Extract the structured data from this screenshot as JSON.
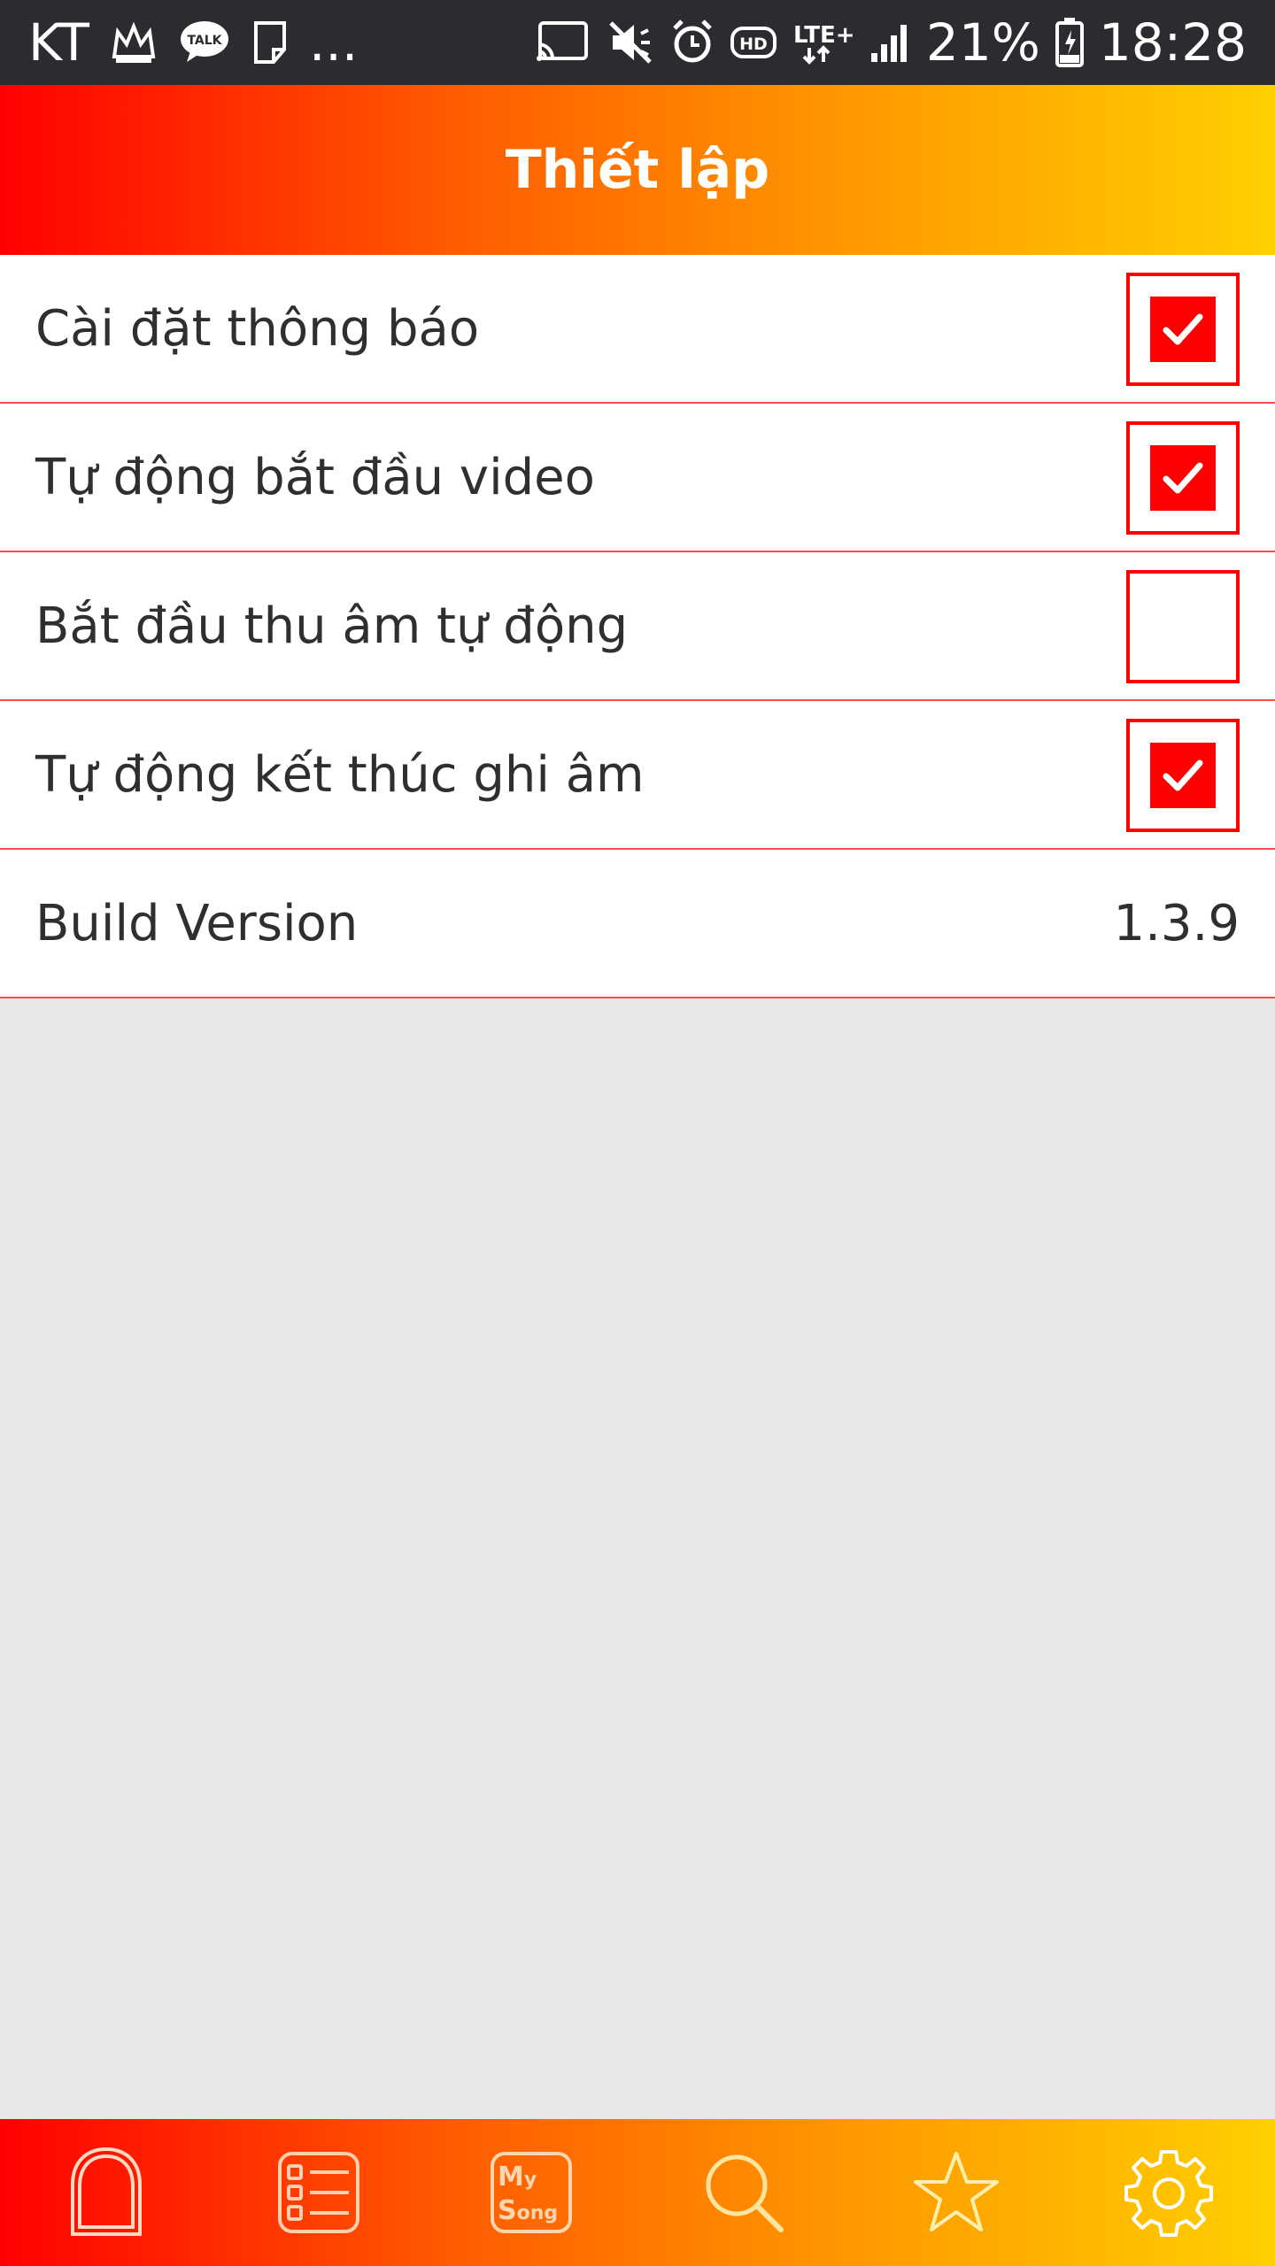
{
  "status_bar": {
    "carrier": "KT",
    "more": "...",
    "network": "LTE+",
    "battery": "21%",
    "time": "18:28",
    "left_icons": [
      "crown-icon",
      "kakaotalk-icon",
      "note-icon"
    ],
    "right_icons": [
      "cast-icon",
      "mute-icon",
      "alarm-icon",
      "hd-icon",
      "lte-icon",
      "signal-icon",
      "battery-icon"
    ]
  },
  "header": {
    "title": "Thiết lập"
  },
  "settings": [
    {
      "label": "Cài đặt thông báo",
      "checked": true
    },
    {
      "label": "Tự động bắt đầu video",
      "checked": true
    },
    {
      "label": "Bắt đầu thu âm tự động",
      "checked": false
    },
    {
      "label": "Tự động kết thúc ghi âm",
      "checked": true
    }
  ],
  "build": {
    "label": "Build Version",
    "value": "1.3.9"
  },
  "bottom_nav": {
    "items": [
      "home-icon",
      "list-icon",
      "my-song-icon",
      "search-icon",
      "favorites-star-icon",
      "settings-gear-icon"
    ],
    "my_song": {
      "line1_big": "M",
      "line1_small": "y",
      "line2_big": "S",
      "line2_small": "ong"
    }
  },
  "colors": {
    "accent": "#ff0000",
    "gradient_start": "#ff0000",
    "gradient_end": "#ffd000",
    "status_bar": "#2c2b30",
    "background": "#e8e8e8"
  }
}
